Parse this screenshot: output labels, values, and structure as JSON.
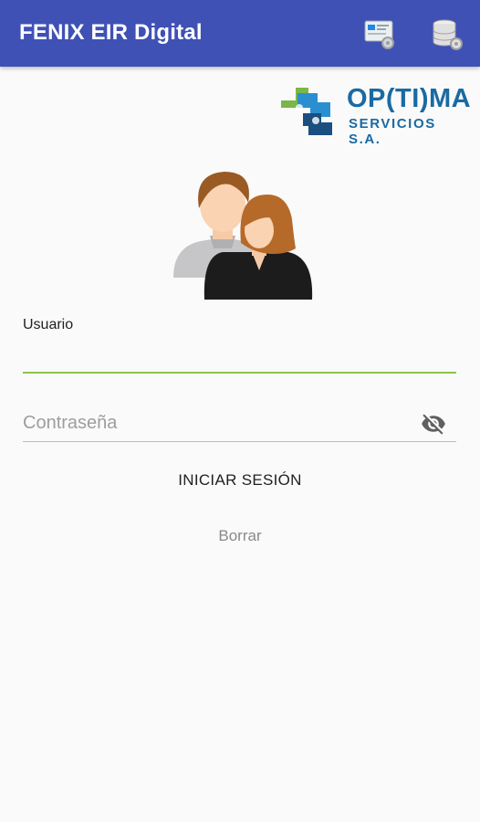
{
  "app_bar": {
    "title": "FENIX EIR Digital",
    "background": "#3f51b5",
    "actions": [
      {
        "icon": "server-settings-icon"
      },
      {
        "icon": "database-settings-icon"
      }
    ]
  },
  "logo": {
    "brand": "OP(TI)MA",
    "subtitle": "SERVICIOS S.A.",
    "colors": {
      "blue": "#1a6aa3",
      "green": "#7ab648"
    }
  },
  "avatar": {
    "icon": "users-avatar-icon"
  },
  "login_form": {
    "username": {
      "label": "Usuario",
      "value": ""
    },
    "password": {
      "placeholder": "Contraseña",
      "value": "",
      "toggle_icon": "visibility-off-icon"
    },
    "submit_label": "INICIAR SESIÓN",
    "clear_label": "Borrar",
    "accent_color": "#8bc34a"
  }
}
